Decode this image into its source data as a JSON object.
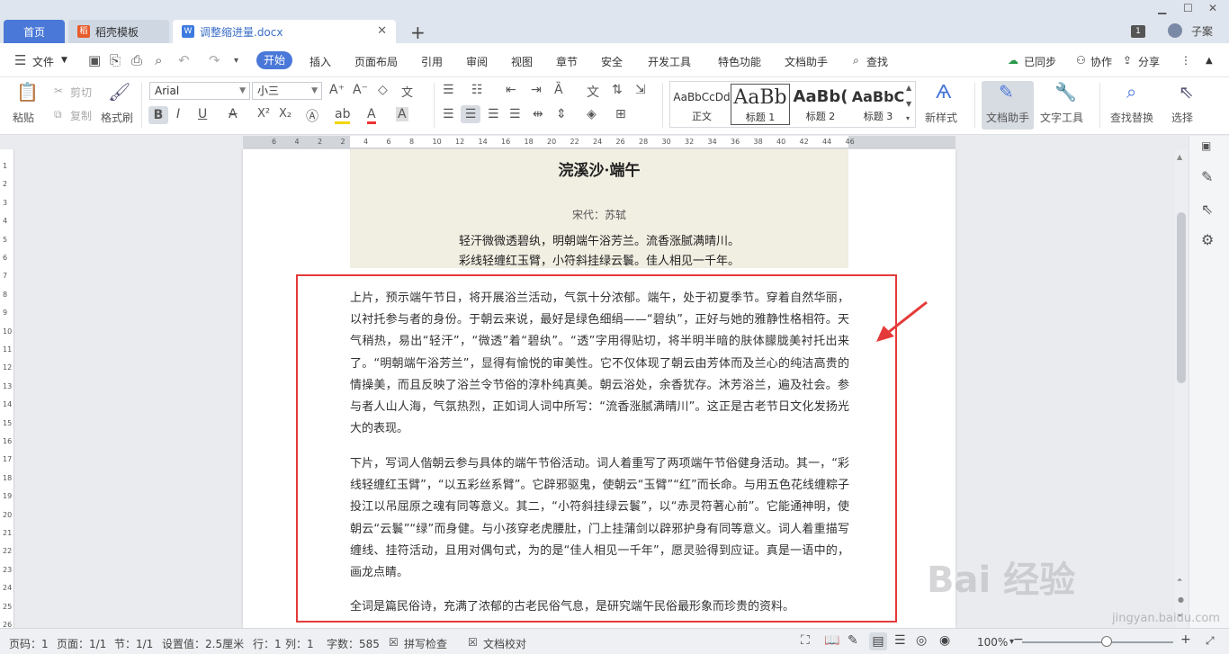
{
  "tabs": {
    "home": "首页",
    "templates": "稻壳模板",
    "doc": "调整缩进量.docx",
    "new_tab": "+",
    "doc_badge": "W",
    "templates_badge": "稻"
  },
  "window": {
    "badge": "1",
    "user": "子案"
  },
  "menu": {
    "file": "文件",
    "items": [
      "开始",
      "插入",
      "页面布局",
      "引用",
      "审阅",
      "视图",
      "章节",
      "安全",
      "开发工具",
      "特色功能",
      "文档助手",
      "查找"
    ],
    "sync": "已同步",
    "collab": "协作",
    "share": "分享"
  },
  "ribbon": {
    "paste": "粘贴",
    "cut": "剪切",
    "copy": "复制",
    "format_painter": "格式刷",
    "font_name": "Arial",
    "font_size": "小三",
    "styles": [
      {
        "preview": "AaBbCcDd",
        "name": "正文"
      },
      {
        "preview": "AaBb",
        "name": "标题 1"
      },
      {
        "preview": "AaBb(",
        "name": "标题 2"
      },
      {
        "preview": "AaBbC",
        "name": "标题 3"
      }
    ],
    "new_style": "新样式",
    "doc_assistant": "文档助手",
    "text_tools": "文字工具",
    "find_replace": "查找替换",
    "select": "选择"
  },
  "ruler": {
    "h_numbers": [
      "6",
      "4",
      "2",
      "2",
      "4",
      "6",
      "8",
      "10",
      "12",
      "14",
      "16",
      "18",
      "20",
      "22",
      "24",
      "26",
      "28",
      "30",
      "32",
      "34",
      "36",
      "38",
      "40",
      "42",
      "44",
      "46"
    ],
    "v_numbers": [
      "1",
      "2",
      "3",
      "4",
      "5",
      "6",
      "7",
      "8",
      "9",
      "10",
      "11",
      "12",
      "13",
      "14",
      "15",
      "16",
      "17",
      "18",
      "19",
      "20",
      "21",
      "22",
      "23",
      "24",
      "25",
      "26"
    ]
  },
  "document": {
    "title": "浣溪沙·端午",
    "author": "宋代：苏轼",
    "lines": [
      "轻汗微微透碧纨，明朝端午浴芳兰。流香涨腻满晴川。",
      "彩线轻缠红玉臂，小符斜挂绿云鬟。佳人相见一千年。"
    ],
    "paragraphs": [
      "上片，预示端午节日，将开展浴兰活动，气氛十分浓郁。端午，处于初夏季节。穿着自然华丽，以衬托参与者的身份。于朝云来说，最好是绿色细绢——“碧纨”，正好与她的雅静性格相符。天气稍热，易出“轻汗”，“微透”着“碧纨”。“透”字用得贴切，将半明半暗的肤体朦胧美衬托出来了。“明朝端午浴芳兰”，显得有愉悦的审美性。它不仅体现了朝云由芳体而及兰心的纯洁高贵的情操美，而且反映了浴兰令节俗的淳朴纯真美。朝云浴处，余香犹存。沐芳浴兰，遍及社会。参与者人山人海，气氛热烈，正如词人词中所写：“流香涨腻满晴川”。这正是古老节日文化发扬光大的表现。",
      "下片，写词人偕朝云参与具体的端午节俗活动。词人着重写了两项端午节俗健身活动。其一，“彩线轻缠红玉臂”，“以五彩丝系臂”。它辟邪驱鬼，使朝云“玉臂”“红”而长命。与用五色花线缠粽子投江以吊屈原之魂有同等意义。其二，“小符斜挂绿云鬟”，以“赤灵符著心前”。它能通神明，使朝云“云鬟”“绿”而身健。与小孩穿老虎腰肚，门上挂蒲剑以辟邪护身有同等意义。词人着重描写缠线、挂符活动，且用对偶句式，为的是“佳人相见一千年”，愿灵验得到应证。真是一语中的，画龙点睛。",
      "全词是篇民俗诗，充满了浓郁的古老民俗气息，是研究端午民俗最形象而珍贵的资料。"
    ]
  },
  "status": {
    "page_num": "页码：1",
    "page": "页面：1/1",
    "section": "节：1/1",
    "setting": "设置值：2.5厘米",
    "row": "行：1",
    "col": "列：1",
    "words": "字数：585",
    "spell": "拼写检查",
    "proof": "文档校对",
    "zoom": "100%"
  },
  "watermark": {
    "main": "Bai 经验",
    "sub": "jingyan.baidu.com"
  },
  "colors": {
    "accent": "#4a78d8",
    "highlight_border": "#e53a3a",
    "poem_bg": "#f1eee2"
  }
}
